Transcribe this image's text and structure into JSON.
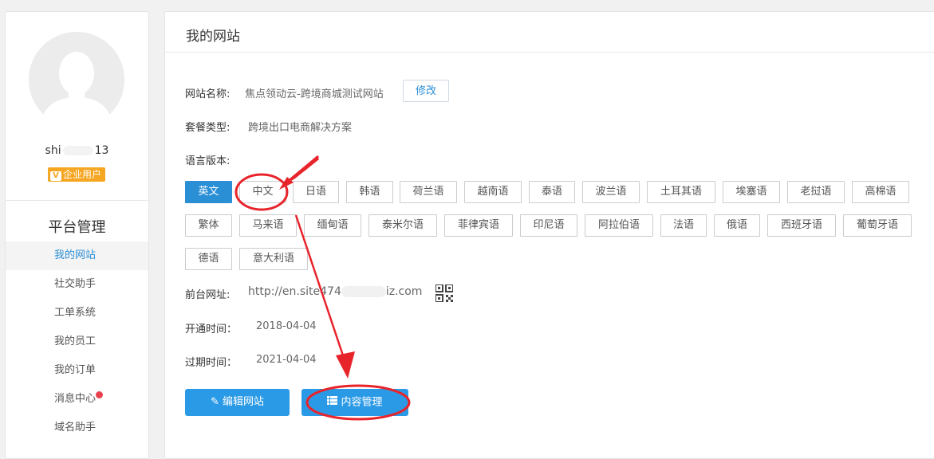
{
  "sidebar": {
    "username_prefix": "shi",
    "username_suffix": "13",
    "badge_icon": "V",
    "badge_label": "企业用户",
    "section_title": "平台管理",
    "items": [
      {
        "label": "我的网站",
        "active": true
      },
      {
        "label": "社交助手"
      },
      {
        "label": "工单系统"
      },
      {
        "label": "我的员工"
      },
      {
        "label": "我的订单"
      },
      {
        "label": "消息中心",
        "has_notification": true
      },
      {
        "label": "域名助手"
      }
    ]
  },
  "main": {
    "title": "我的网站",
    "site_name_label": "网站名称:",
    "site_name_value": "焦点领动云-跨境商城测试网站",
    "edit_label": "修改",
    "package_label": "套餐类型:",
    "package_value": "跨境出口电商解决方案",
    "languages_label": "语言版本:",
    "languages": [
      "英文",
      "中文",
      "日语",
      "韩语",
      "荷兰语",
      "越南语",
      "泰语",
      "波兰语",
      "土耳其语",
      "埃塞语",
      "老挝语",
      "高棉语",
      "繁体",
      "马来语",
      "缅甸语",
      "泰米尔语",
      "菲律宾语",
      "印尼语",
      "阿拉伯语",
      "法语",
      "俄语",
      "西班牙语",
      "葡萄牙语",
      "德语",
      "意大利语"
    ],
    "active_language": "英文",
    "frontend_url_label": "前台网址:",
    "frontend_url_start": "http://en.site",
    "frontend_url_mid": "474",
    "frontend_url_end": "iz.com",
    "open_time_label": "开通时间：",
    "open_time_value": "2018-04-04",
    "expire_time_label": "过期时间：",
    "expire_time_value": "2021-04-04",
    "edit_site_label": "编辑网站",
    "content_manage_label": "内容管理"
  },
  "colors": {
    "accent": "#2b8fd6",
    "badge": "#f5a623",
    "annotation": "#e8242b",
    "notification": "#e8424e"
  }
}
